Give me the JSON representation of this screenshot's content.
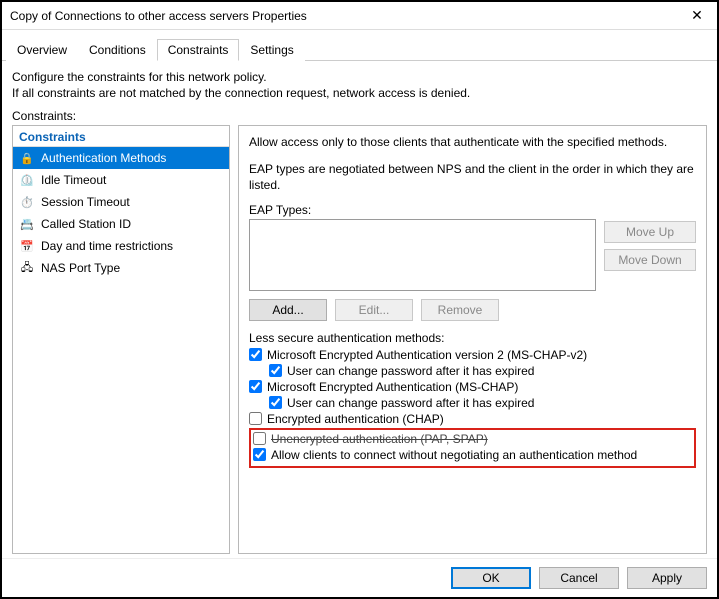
{
  "window": {
    "title": "Copy of Connections to other access servers Properties"
  },
  "tabs": [
    {
      "label": "Overview"
    },
    {
      "label": "Conditions"
    },
    {
      "label": "Constraints"
    },
    {
      "label": "Settings"
    }
  ],
  "activeTab": "Constraints",
  "intro1": "Configure the constraints for this network policy.",
  "intro2": "If all constraints are not matched by the connection request, network access is denied.",
  "sidebar_label": "Constraints:",
  "sidebar": {
    "group": "Constraints",
    "items": [
      {
        "label": "Authentication Methods",
        "icon": "lock"
      },
      {
        "label": "Idle Timeout",
        "icon": "idle"
      },
      {
        "label": "Session Timeout",
        "icon": "session"
      },
      {
        "label": "Called Station ID",
        "icon": "station"
      },
      {
        "label": "Day and time restrictions",
        "icon": "calendar"
      },
      {
        "label": "NAS Port Type",
        "icon": "port"
      }
    ],
    "selected": "Authentication Methods"
  },
  "panel": {
    "allow_text": "Allow access only to those clients that authenticate with the specified methods.",
    "eap_text": "EAP types are negotiated between NPS and the client in the order in which they are listed.",
    "eap_label": "EAP Types:",
    "moveup": "Move Up",
    "movedown": "Move Down",
    "add": "Add...",
    "edit": "Edit...",
    "remove": "Remove",
    "less_secure": "Less secure authentication methods:",
    "chk1": "Microsoft Encrypted Authentication version 2 (MS-CHAP-v2)",
    "chk1a": "User can change password after it has expired",
    "chk2": "Microsoft Encrypted Authentication (MS-CHAP)",
    "chk2a": "User can change password after it has expired",
    "chk3": "Encrypted authentication (CHAP)",
    "chk4": "Unencrypted authentication (PAP, SPAP)",
    "chk5": "Allow clients to connect without negotiating an authentication method"
  },
  "footer": {
    "ok": "OK",
    "cancel": "Cancel",
    "apply": "Apply"
  }
}
